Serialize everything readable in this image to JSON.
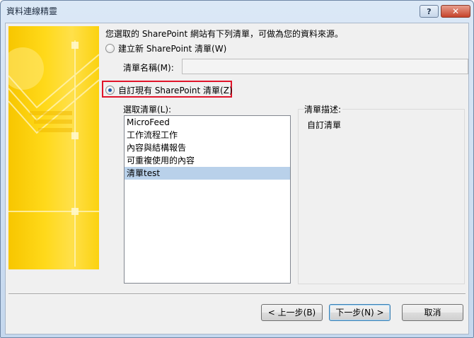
{
  "window": {
    "title": "資料連線精靈",
    "help_glyph": "?",
    "close_glyph": "✕"
  },
  "intro_text": "您選取的 SharePoint 網站有下列清單，可做為您的資料來源。",
  "options": {
    "create_new_label": "建立新 SharePoint 清單(W)",
    "create_new_selected": false,
    "customize_existing_label": "自訂現有 SharePoint 清單(Z)",
    "customize_existing_selected": true
  },
  "list_name": {
    "label": "清單名稱(M):",
    "value": ""
  },
  "select_list": {
    "label": "選取清單(L):",
    "items": [
      "MicroFeed",
      "工作流程工作",
      "內容與結構報告",
      "可重複使用的內容",
      "清單test"
    ],
    "selected_index": 4
  },
  "description": {
    "label": "清單描述:",
    "text": "自訂清單"
  },
  "buttons": {
    "back": "< 上一步(B)",
    "next": "下一步(N) >",
    "cancel": "取消"
  },
  "colors": {
    "highlight_border": "#e0142a",
    "selection": "#b9d1ea",
    "banner": "#f7c600"
  }
}
